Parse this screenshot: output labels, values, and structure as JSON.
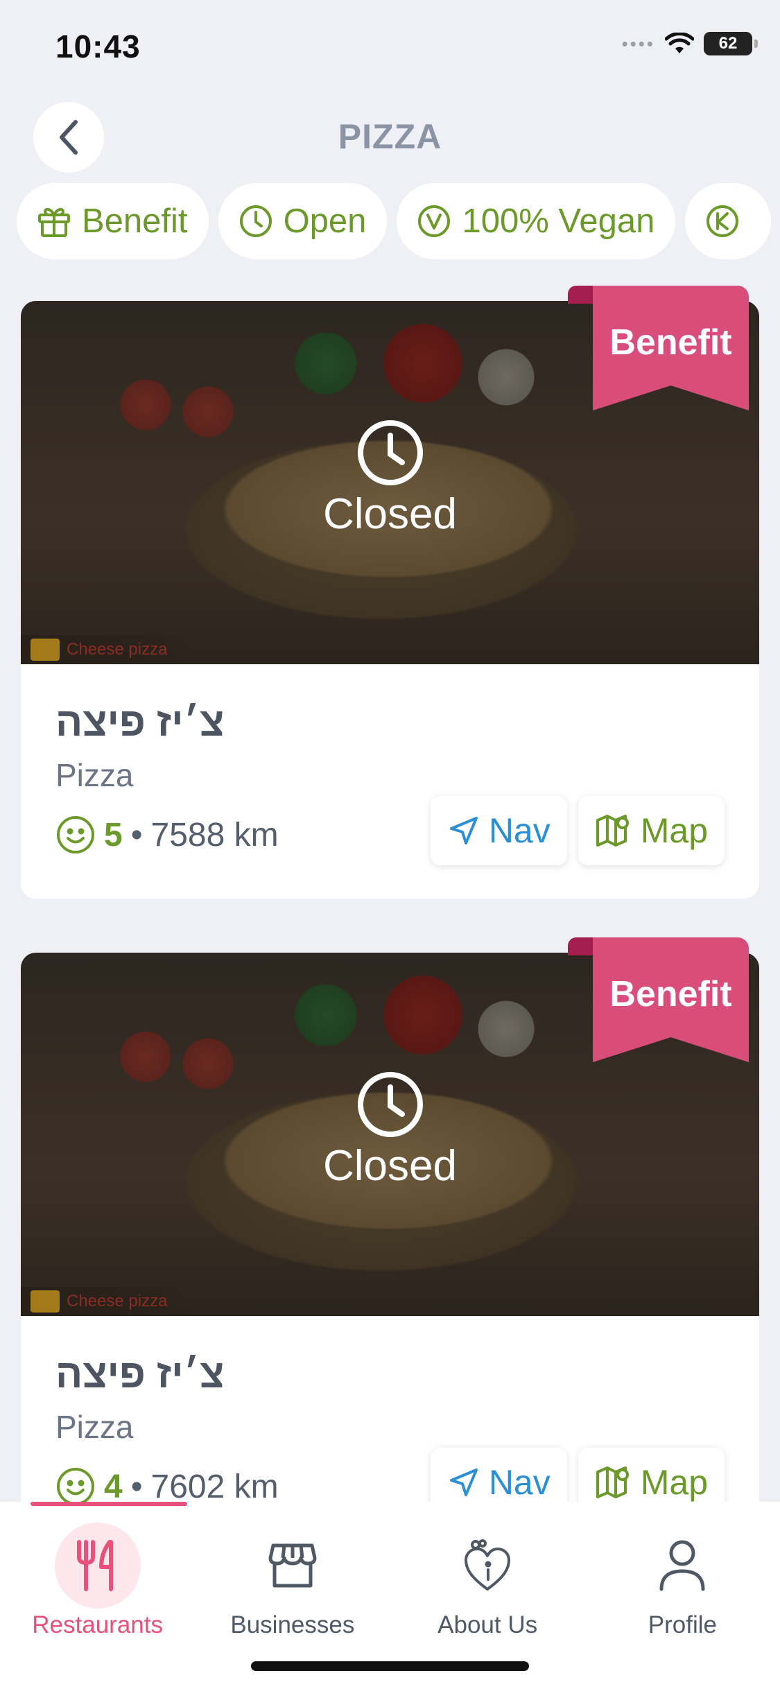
{
  "status_bar": {
    "time": "10:43",
    "battery": "62"
  },
  "header": {
    "title": "PIZZA"
  },
  "filters": [
    {
      "label": "Benefit",
      "icon": "gift-icon"
    },
    {
      "label": "Open",
      "icon": "clock-icon"
    },
    {
      "label": "100% Vegan",
      "icon": "vegan-icon"
    },
    {
      "label": "",
      "icon": "kosher-icon"
    }
  ],
  "cards": [
    {
      "badge": "Benefit",
      "status": "Closed",
      "image_caption": "Cheese pizza",
      "name": "צ׳יז פיצה",
      "category": "Pizza",
      "rating": "5",
      "separator": "•",
      "distance": "7588 km",
      "nav_label": "Nav",
      "map_label": "Map"
    },
    {
      "badge": "Benefit",
      "status": "Closed",
      "image_caption": "Cheese pizza",
      "name": "צ׳יז פיצה",
      "category": "Pizza",
      "rating": "4",
      "separator": "•",
      "distance": "7602 km",
      "nav_label": "Nav",
      "map_label": "Map"
    }
  ],
  "tabs": [
    {
      "label": "Restaurants",
      "icon": "fork-knife-icon",
      "active": true
    },
    {
      "label": "Businesses",
      "icon": "storefront-icon",
      "active": false
    },
    {
      "label": "About Us",
      "icon": "heart-info-icon",
      "active": false
    },
    {
      "label": "Profile",
      "icon": "person-icon",
      "active": false
    }
  ],
  "colors": {
    "accent": "#e8517b",
    "green": "#6b9a2b",
    "nav_blue": "#2b8fd6",
    "ribbon": "#d94d7a"
  }
}
